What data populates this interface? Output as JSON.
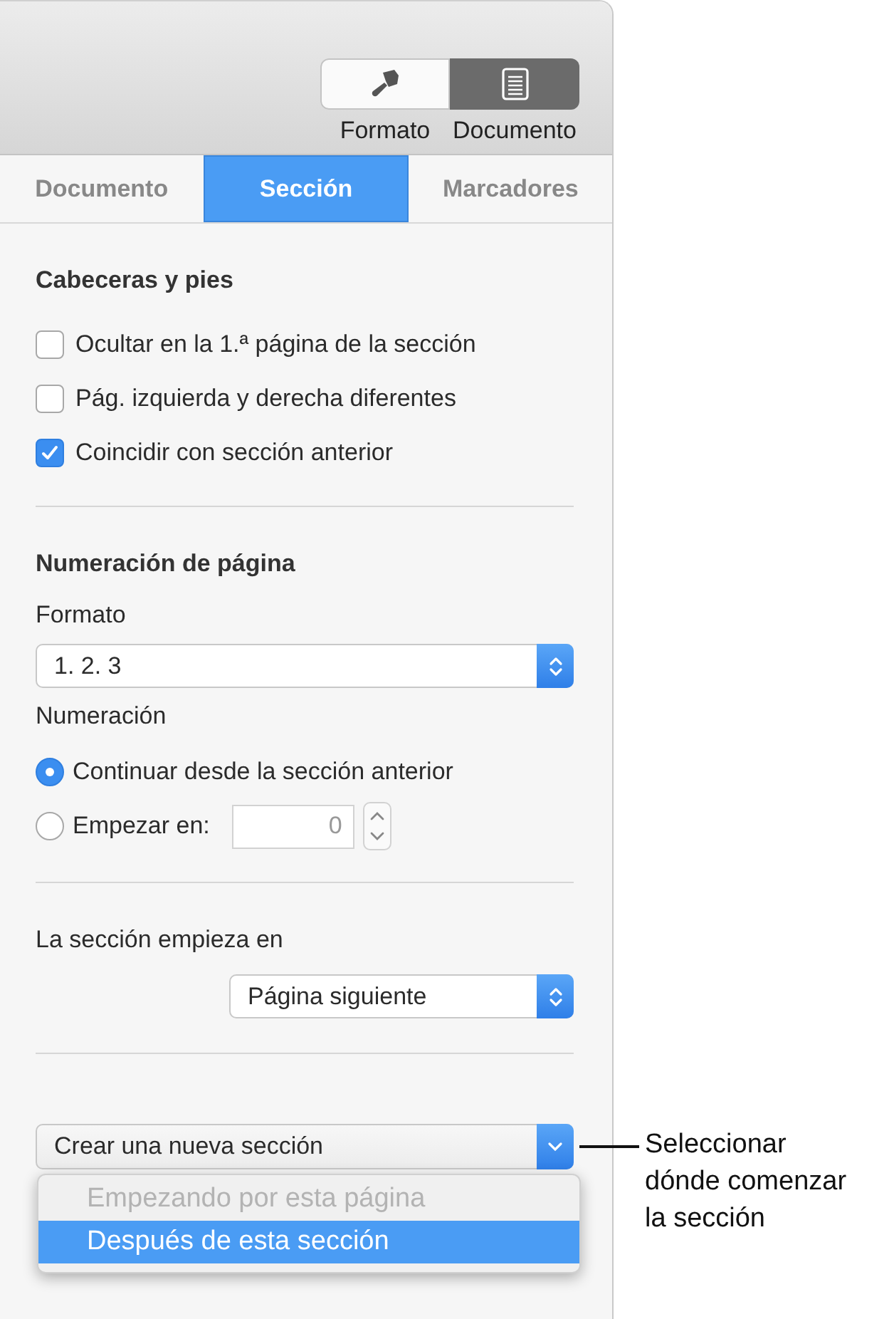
{
  "toolbar": {
    "buttons": [
      {
        "label": "Formato",
        "selected": false
      },
      {
        "label": "Documento",
        "selected": true
      }
    ]
  },
  "tabs": [
    {
      "label": "Documento",
      "selected": false
    },
    {
      "label": "Sección",
      "selected": true
    },
    {
      "label": "Marcadores",
      "selected": false
    }
  ],
  "header_footer": {
    "title": "Cabeceras y pies",
    "options": [
      {
        "label": "Ocultar en la 1.ª página de la sección",
        "checked": false
      },
      {
        "label": "Pág. izquierda y derecha diferentes",
        "checked": false
      },
      {
        "label": "Coincidir con sección anterior",
        "checked": true
      }
    ]
  },
  "page_numbering": {
    "title": "Numeración de página",
    "format_label": "Formato",
    "format_value": "1. 2. 3",
    "numbering_label": "Numeración",
    "options": [
      {
        "label": "Continuar desde la sección anterior",
        "selected": true
      },
      {
        "label": "Empezar en:",
        "selected": false,
        "placeholder": "0"
      }
    ]
  },
  "section_start": {
    "label": "La sección empieza en",
    "value": "Página siguiente"
  },
  "new_section": {
    "value": "Crear una nueva sección",
    "menu": [
      {
        "label": "Empezando por esta página",
        "disabled": true,
        "selected": false
      },
      {
        "label": "Después de esta sección",
        "disabled": false,
        "selected": true
      }
    ]
  },
  "callout": {
    "text": "Seleccionar dónde comenzar la sección"
  }
}
